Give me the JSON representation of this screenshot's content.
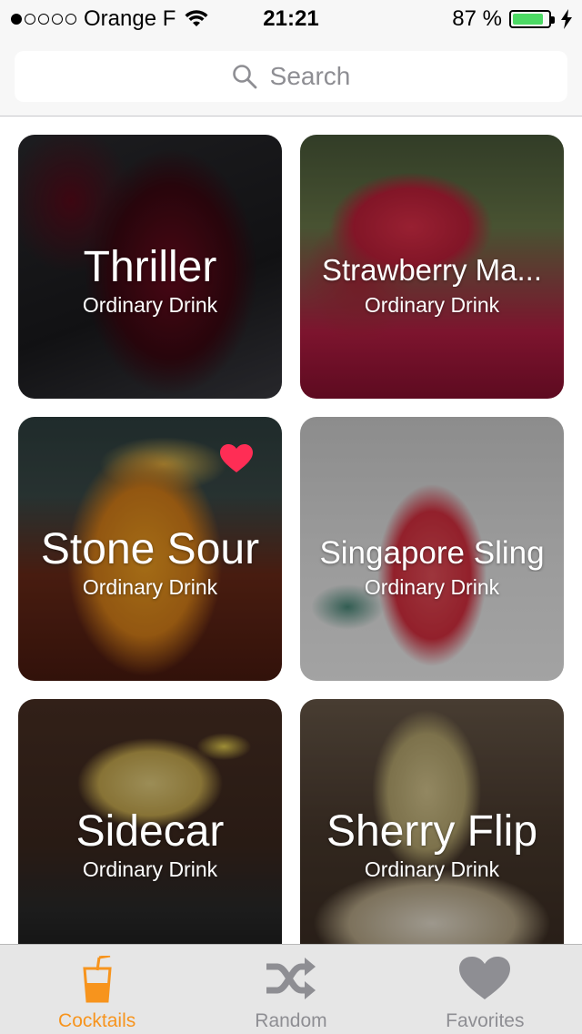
{
  "status_bar": {
    "carrier": "Orange F",
    "signal_bars_filled": 1,
    "signal_bars_total": 5,
    "time": "21:21",
    "battery_percent": "87 %",
    "battery_level": 0.87
  },
  "search": {
    "placeholder": "Search"
  },
  "cocktails": [
    {
      "name": "Thriller",
      "category": "Ordinary Drink",
      "favorite": false
    },
    {
      "name": "Strawberry Ma...",
      "category": "Ordinary Drink",
      "favorite": false
    },
    {
      "name": "Stone Sour",
      "category": "Ordinary Drink",
      "favorite": true
    },
    {
      "name": "Singapore Sling",
      "category": "Ordinary Drink",
      "favorite": false
    },
    {
      "name": "Sidecar",
      "category": "Ordinary Drink",
      "favorite": false
    },
    {
      "name": "Sherry Flip",
      "category": "Ordinary Drink",
      "favorite": false
    }
  ],
  "tab_bar": {
    "tabs": [
      {
        "label": "Cocktails",
        "icon": "cocktail-glass-icon",
        "active": true
      },
      {
        "label": "Random",
        "icon": "shuffle-icon",
        "active": false
      },
      {
        "label": "Favorites",
        "icon": "heart-icon",
        "active": false
      }
    ]
  },
  "colors": {
    "accent": "#f7941d",
    "favorite": "#ff2d55",
    "battery": "#4cd964",
    "inactive": "#8e8e93"
  }
}
